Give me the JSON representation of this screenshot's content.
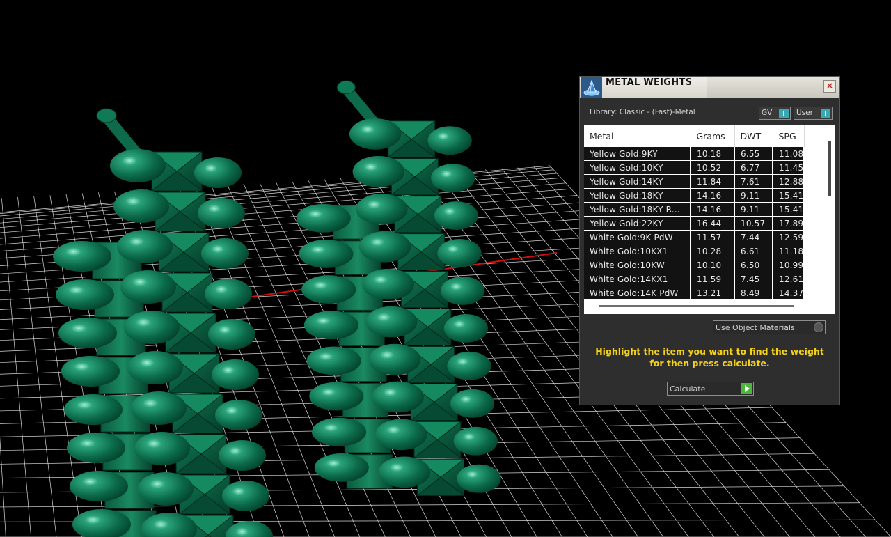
{
  "panel": {
    "title": "METAL WEIGHTS",
    "close_label": "×",
    "library_label": "Library: Classic - (Fast)-Metal",
    "gv_label": "GV",
    "user_label": "User",
    "columns": [
      "Metal",
      "Grams",
      "DWT",
      "SPG"
    ],
    "rows": [
      {
        "metal": "Yellow Gold:9KY",
        "grams": "10.18",
        "dwt": "6.55",
        "spg": "11.08"
      },
      {
        "metal": "Yellow Gold:10KY",
        "grams": "10.52",
        "dwt": "6.77",
        "spg": "11.45"
      },
      {
        "metal": "Yellow Gold:14KY",
        "grams": "11.84",
        "dwt": "7.61",
        "spg": "12.88"
      },
      {
        "metal": "Yellow Gold:18KY",
        "grams": "14.16",
        "dwt": "9.11",
        "spg": "15.41"
      },
      {
        "metal": "Yellow Gold:18KY R...",
        "grams": "14.16",
        "dwt": "9.11",
        "spg": "15.41"
      },
      {
        "metal": "Yellow Gold:22KY",
        "grams": "16.44",
        "dwt": "10.57",
        "spg": "17.89"
      },
      {
        "metal": "White Gold:9K PdW",
        "grams": "11.57",
        "dwt": "7.44",
        "spg": "12.59"
      },
      {
        "metal": "White Gold:10KX1",
        "grams": "10.28",
        "dwt": "6.61",
        "spg": "11.18"
      },
      {
        "metal": "White Gold:10KW",
        "grams": "10.10",
        "dwt": "6.50",
        "spg": "10.99"
      },
      {
        "metal": "White Gold:14KX1",
        "grams": "11.59",
        "dwt": "7.45",
        "spg": "12.61"
      },
      {
        "metal": "White Gold:14K PdW",
        "grams": "13.21",
        "dwt": "8.49",
        "spg": "14.37"
      }
    ],
    "materials_label": "Use Object Materials",
    "instruction": "Highlight the item you want to find the weight for then press calculate.",
    "calculate_label": "Calculate"
  },
  "icons": {
    "app": "rhino-gem-icon",
    "close": "close-icon",
    "toggle": "toggle-knob-icon",
    "materials": "dropdown-knob-icon",
    "calculate": "play-arrow-icon"
  },
  "colors": {
    "background": "#000000",
    "grid": "#ffffff",
    "model": "#0d6b4c",
    "axis_x": "#cc1111",
    "axis_y": "#2aa5b5",
    "instruction": "#f5d21a",
    "accent": "#3aa7b5",
    "calc_arrow": "#4ab63a"
  }
}
